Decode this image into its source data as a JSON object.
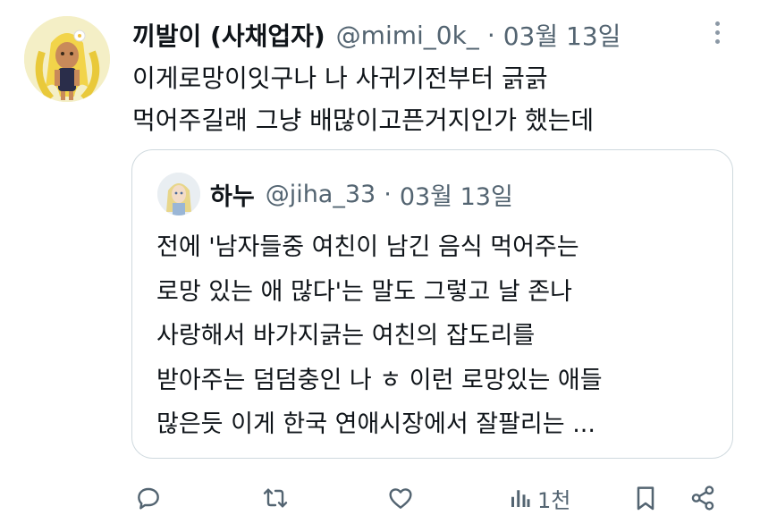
{
  "tweet": {
    "author_name": "끼발이 (사채업자)",
    "handle": "@mimi_0k_",
    "separator": "·",
    "date": "03월 13일",
    "text_lines": [
      "이게로망이잇구나 나 사귀기전부터 긁긁",
      "먹어주길래 그냥 배많이고픈거지인가 했는데"
    ]
  },
  "quoted_tweet": {
    "author_name": "하누",
    "handle": "@jiha_33",
    "separator": "·",
    "date": "03월 13일",
    "text_lines": [
      "전에 '남자들중 여친이 남긴 음식 먹어주는",
      "로망 있는 애 많다'는 말도 그렇고 날 존나",
      "사랑해서 바가지긁는 여친의 잡도리를",
      "받아주는 덤덤충인 나 ㅎ 이런 로망있는 애들",
      "많은듯 이게 한국 연애시장에서 잘팔리는 ..."
    ]
  },
  "actions": {
    "views_count": "1천",
    "icons": [
      "reply-icon",
      "retweet-icon",
      "like-icon",
      "views-icon",
      "bookmark-icon",
      "share-icon"
    ]
  },
  "colors": {
    "text": "#0f1419",
    "secondary": "#536471",
    "border": "#cfd9de"
  }
}
